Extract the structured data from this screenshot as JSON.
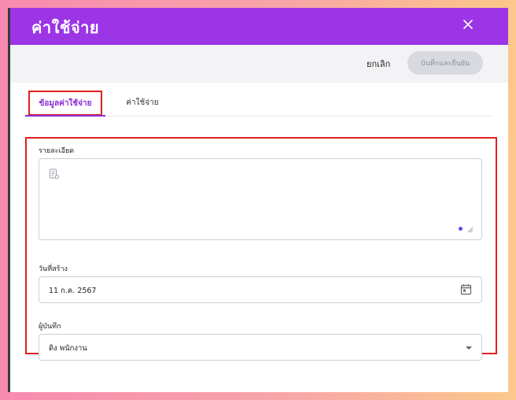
{
  "dialog": {
    "title": "ค่าใช้จ่าย",
    "close_icon": "close-icon"
  },
  "toolbar": {
    "cancel_label": "ยกเลิก",
    "save_label": "บันทึกและยืนยัน"
  },
  "tabs": [
    {
      "label": "ข้อมูลค่าใช้จ่าย",
      "active": true
    },
    {
      "label": "ค่าใช้จ่าย",
      "active": false
    }
  ],
  "form": {
    "details": {
      "label": "รายละเอียด",
      "value": "",
      "icon": "document-icon"
    },
    "created_date": {
      "label": "วันที่สร้าง",
      "value": "11 ก.ค. 2567",
      "icon": "calendar-icon"
    },
    "recorder": {
      "label": "ผู้บันทึก",
      "value": "ดิง พนักงาน",
      "icon": "chevron-down-icon"
    }
  },
  "colors": {
    "accent": "#9b35e6",
    "highlight": "#e02020",
    "save_button_disabled": "#d9d9e0"
  }
}
